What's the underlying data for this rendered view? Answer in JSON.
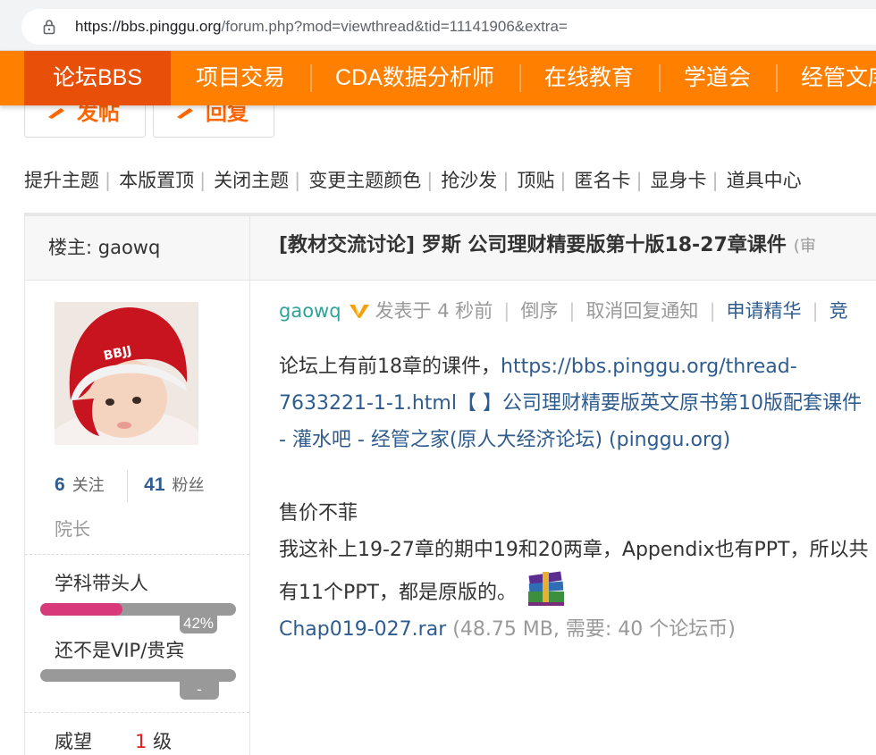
{
  "browser": {
    "url_host": "https://bbs.pinggu.org",
    "url_path": "/forum.php?mod=viewthread&tid=11141906&extra="
  },
  "nav": {
    "items": [
      "论坛BBS",
      "项目交易",
      "CDA数据分析师",
      "在线教育",
      "学道会",
      "经管文库"
    ]
  },
  "actions": {
    "post_label": "发帖",
    "reply_label": "回复"
  },
  "toolbar": {
    "items": [
      "提升主题",
      "本版置顶",
      "关闭主题",
      "变更主题颜色",
      "抢沙发",
      "顶贴",
      "匿名卡",
      "显身卡",
      "道具中心"
    ]
  },
  "post": {
    "owner_label": "楼主: gaowq",
    "title": "[教材交流讨论] 罗斯 公司理财精要版第十版18-27章课件",
    "title_suffix": "(审",
    "author": "gaowq",
    "posted": "发表于 4 秒前",
    "reverse": "倒序",
    "cancel_notify": "取消回复通知",
    "apply_digest": "申请精华",
    "more": "竞",
    "content": {
      "intro": "论坛上有前18章的课件，",
      "link_text": "https://bbs.pinggu.org/thread-7633221-1-1.html【          】公司理财精要版英文原书第10版配套课件 - 灌水吧 - 经管之家(原人大经济论坛) (pinggu.org)",
      "price": "售价不菲",
      "desc": "我这补上19-27章的期中19和20两章，Appendix也有PPT，所以共有11个PPT，都是原版的。",
      "attachment_name": "Chap019-027.rar",
      "attachment_info": "(48.75 MB, 需要: 40 个论坛币)"
    }
  },
  "profile": {
    "follow_count": "6",
    "follow_label": "关注",
    "fans_count": "41",
    "fans_label": "粉丝",
    "rank": "院长",
    "level1_name": "学科带头人",
    "level1_progress_text": "42%",
    "level1_progress": 0.42,
    "level2_name": "还不是VIP/贵宾",
    "level2_progress_text": "-",
    "prestige_label": "威望",
    "prestige_value": "1",
    "prestige_unit": "级"
  },
  "colors": {
    "nav_orange": "#ff7f00",
    "nav_active": "#e8500a",
    "link_blue": "#2f5c8f",
    "author_teal": "#2ea39a",
    "progress_pink": "#d8397a"
  }
}
